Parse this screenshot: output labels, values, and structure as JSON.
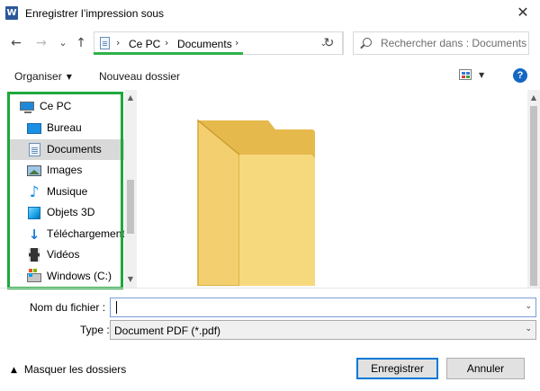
{
  "window": {
    "app_icon": "word-icon",
    "title": "Enregistrer l’impression sous",
    "close": "✕"
  },
  "nav": {
    "back": "←",
    "forward": "→",
    "recent": "⌄",
    "up": "↑",
    "breadcrumbs": [
      "Ce PC",
      "Documents"
    ],
    "crumb_sep": "›",
    "dropdown": "⌄",
    "refresh": "↻",
    "search_placeholder": "Rechercher dans : Documents"
  },
  "toolbar": {
    "organize": "Organiser",
    "new_folder": "Nouveau dossier",
    "help": "?"
  },
  "sidebar": {
    "items": [
      {
        "label": "Ce PC",
        "icon": "computer-icon"
      },
      {
        "label": "Bureau",
        "icon": "desktop-icon"
      },
      {
        "label": "Documents",
        "icon": "documents-icon",
        "selected": true
      },
      {
        "label": "Images",
        "icon": "pictures-icon"
      },
      {
        "label": "Musique",
        "icon": "music-icon"
      },
      {
        "label": "Objets 3D",
        "icon": "objects-3d-icon"
      },
      {
        "label": "Téléchargements",
        "icon": "downloads-icon"
      },
      {
        "label": "Vidéos",
        "icon": "videos-icon"
      },
      {
        "label": "Windows (C:)",
        "icon": "drive-icon"
      }
    ]
  },
  "form": {
    "filename_label": "Nom du fichier :",
    "filename_value": "",
    "type_label": "Type :",
    "type_value": "Document PDF (*.pdf)"
  },
  "footer": {
    "hide_folders": "Masquer les dossiers",
    "save": "Enregistrer",
    "cancel": "Annuler"
  },
  "colors": {
    "accent": "#0078d7",
    "highlight_frame": "#1fa83c",
    "folder": "#f6d16d"
  }
}
